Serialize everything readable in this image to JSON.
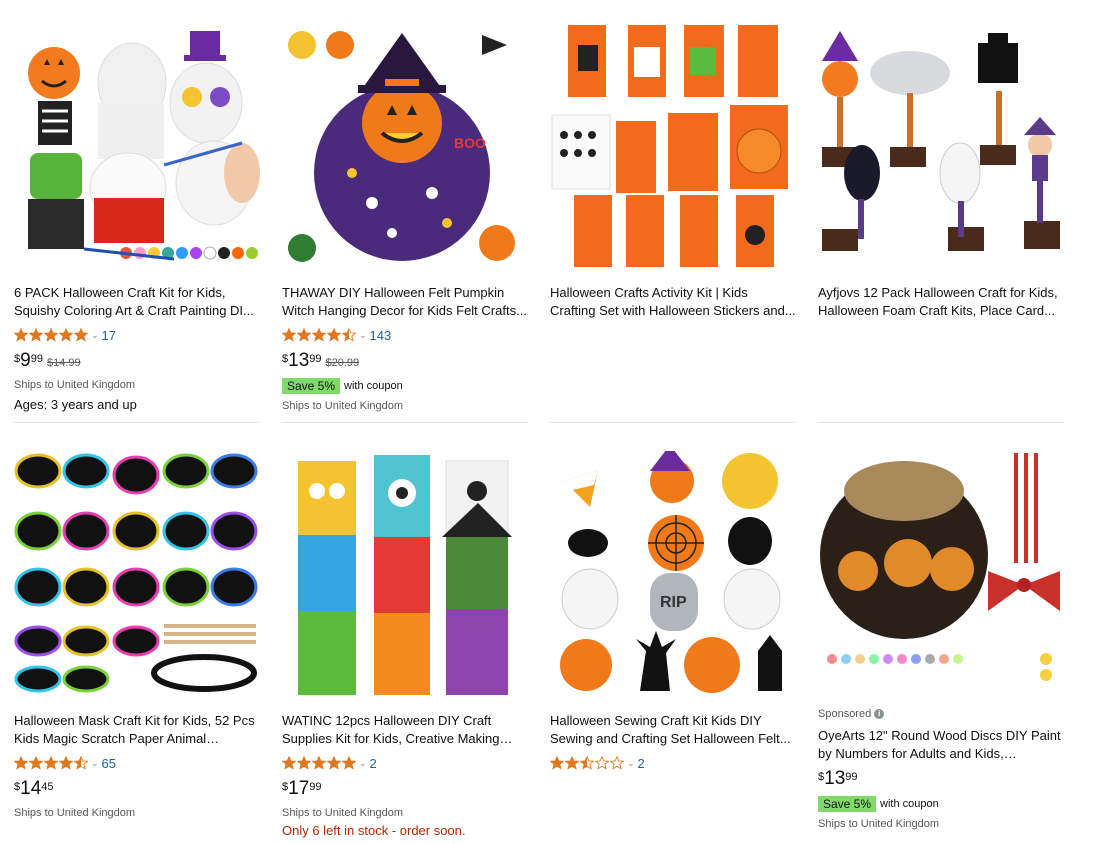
{
  "products": [
    {
      "title": "6 PACK Halloween Craft Kit for Kids, Squishy Coloring Art & Craft Painting DI...",
      "stars": 5,
      "rating_count": "17",
      "price_currency": "$",
      "price_whole": "9",
      "price_fraction": "99",
      "was_price": "$14.99",
      "ships": "Ships to United Kingdom",
      "extra": "Ages: 3 years and up"
    },
    {
      "title": "THAWAY DIY Halloween Felt Pumpkin Witch Hanging Decor for Kids Felt Crafts...",
      "stars": 4.5,
      "rating_count": "143",
      "price_currency": "$",
      "price_whole": "13",
      "price_fraction": "99",
      "was_price": "$20.99",
      "coupon_badge": "Save 5%",
      "coupon_text": "with coupon",
      "ships": "Ships to United Kingdom"
    },
    {
      "title": "Halloween Crafts Activity Kit | Kids Crafting Set with Halloween Stickers and..."
    },
    {
      "title": "Ayfjovs 12 Pack Halloween Craft for Kids, Halloween Foam Craft Kits, Place Card..."
    },
    {
      "title": "Halloween Mask Craft Kit for Kids, 52 Pcs Kids Magic Scratch Paper Animal Masks,...",
      "stars": 4.5,
      "rating_count": "65",
      "price_currency": "$",
      "price_whole": "14",
      "price_fraction": "45",
      "ships": "Ships to United Kingdom"
    },
    {
      "title": "WATINC 12pcs Halloween DIY Craft Supplies Kit for Kids, Creative Making Cra...",
      "stars": 5,
      "rating_count": "2",
      "price_currency": "$",
      "price_whole": "17",
      "price_fraction": "99",
      "ships": "Ships to United Kingdom",
      "stock": "Only 6 left in stock - order soon."
    },
    {
      "title": "Halloween Sewing Craft Kit Kids DIY Sewing and Crafting Set Halloween Felt...",
      "stars": 2.5,
      "rating_count": "2"
    },
    {
      "sponsored": "Sponsored",
      "title": "OyeArts 12\" Round Wood Discs DIY Paint by Numbers for Adults and Kids, Wooden...",
      "price_currency": "$",
      "price_whole": "13",
      "price_fraction": "99",
      "coupon_badge": "Save 5%",
      "coupon_text": "with coupon",
      "ships": "Ships to United Kingdom"
    }
  ],
  "colors": {
    "star": "#de7921",
    "link": "#2162a1",
    "coupon": "#7fda69",
    "stock": "#b12704"
  }
}
